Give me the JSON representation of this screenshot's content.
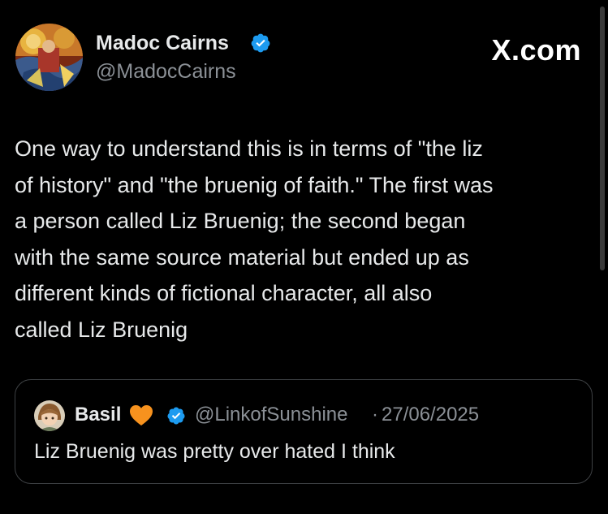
{
  "author": {
    "name": "Madoc Cairns",
    "handle": "@MadocCairns",
    "verified": true,
    "avatar": "painted-artwork-avatar"
  },
  "watermark": "X.com",
  "tweet": {
    "lines": [
      "One way to understand this is in terms of \"the liz",
      "of history\" and \"the bruenig of faith.\" The first was",
      "a person called Liz Bruenig; the second began",
      "with the same source material but ended up as",
      "different kinds of fictional character, all also",
      "called Liz Bruenig"
    ]
  },
  "quoted_tweet": {
    "name": "Basil",
    "name_emoji": "orange-heart-icon",
    "verified": true,
    "handle": "@LinkofSunshine",
    "separator": "·",
    "date": "27/06/2025",
    "text": "Liz Bruenig was pretty over hated I think",
    "avatar": "anime-character-avatar"
  },
  "colors": {
    "background": "#000000",
    "text_primary": "#e7e9ea",
    "text_secondary": "#8b9096",
    "verified_blue": "#1d9bf0",
    "card_border": "#3e4144",
    "heart": "#f7921e"
  }
}
